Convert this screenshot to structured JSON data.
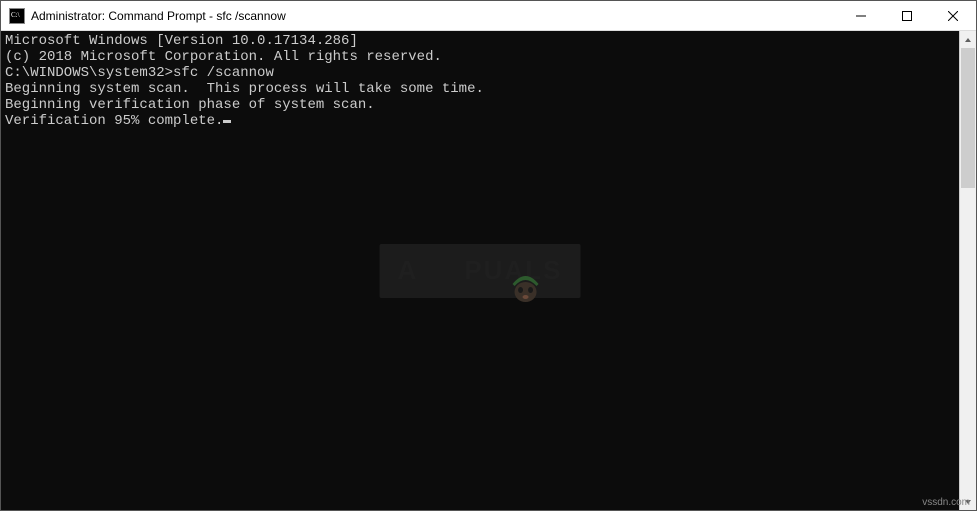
{
  "titlebar": {
    "title": "Administrator: Command Prompt - sfc  /scannow"
  },
  "window_controls": {
    "minimize": "minimize",
    "maximize": "maximize",
    "close": "close"
  },
  "console": {
    "line1": "Microsoft Windows [Version 10.0.17134.286]",
    "line2": "(c) 2018 Microsoft Corporation. All rights reserved.",
    "blank1": "",
    "prompt_line": "C:\\WINDOWS\\system32>sfc /scannow",
    "blank2": "",
    "scan_start": "Beginning system scan.  This process will take some time.",
    "blank3": "",
    "verify_phase": "Beginning verification phase of system scan.",
    "verify_progress": "Verification 95% complete."
  },
  "watermark": {
    "text_left": "A",
    "text_right": "PUALS"
  },
  "source": "vssdn.com"
}
